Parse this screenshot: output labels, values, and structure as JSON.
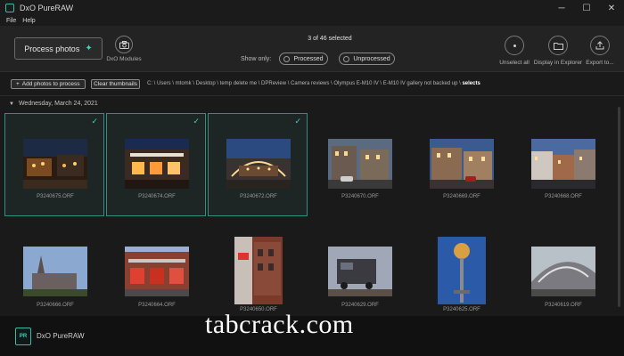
{
  "window": {
    "title": "DxO PureRAW",
    "controls": [
      "─",
      "☐",
      "✕"
    ]
  },
  "menu": [
    "File",
    "Help"
  ],
  "toolbar": {
    "process_label": "Process photos",
    "modules_label": "DxO Modules",
    "selection": "3 of 46 selected",
    "show_only_label": "Show only:",
    "filter_processed": "Processed",
    "filter_unprocessed": "Unprocessed",
    "unselect_all": "Unselect all",
    "display_explorer": "Display in Explorer",
    "export_to": "Export to..."
  },
  "pathbar": {
    "add_photos": "Add photos to process",
    "clear_thumbnails": "Clear thumbnails",
    "path_prefix": "C: \\ Users \\ mtomk \\ Desktop \\ temp delete me \\ DPReview \\ Camera reviews \\ Olympus E-M10 IV \\ E-M10 IV gallery not backed up \\ ",
    "path_current": "selects"
  },
  "date_header": "Wednesday, March 24, 2021",
  "photos": [
    {
      "name": "P3240675.ORF",
      "selected": true
    },
    {
      "name": "P3240674.ORF",
      "selected": true
    },
    {
      "name": "P3240672.ORF",
      "selected": true
    },
    {
      "name": "P3240670.ORF",
      "selected": false
    },
    {
      "name": "P3240669.ORF",
      "selected": false
    },
    {
      "name": "P3240668.ORF",
      "selected": false
    },
    {
      "name": "P3240666.ORF",
      "selected": false
    },
    {
      "name": "P3240664.ORF",
      "selected": false
    },
    {
      "name": "P3240650.ORF",
      "selected": false
    },
    {
      "name": "P3240629.ORF",
      "selected": false
    },
    {
      "name": "P3240625.ORF",
      "selected": false
    },
    {
      "name": "P3240619.ORF",
      "selected": false
    }
  ],
  "footer": {
    "app_name": "DxO PureRAW",
    "logo_text": "PR"
  },
  "watermark": "tabcrack.com",
  "colors": {
    "accent": "#3fd3bd",
    "selected_border": "#2f8f84"
  }
}
